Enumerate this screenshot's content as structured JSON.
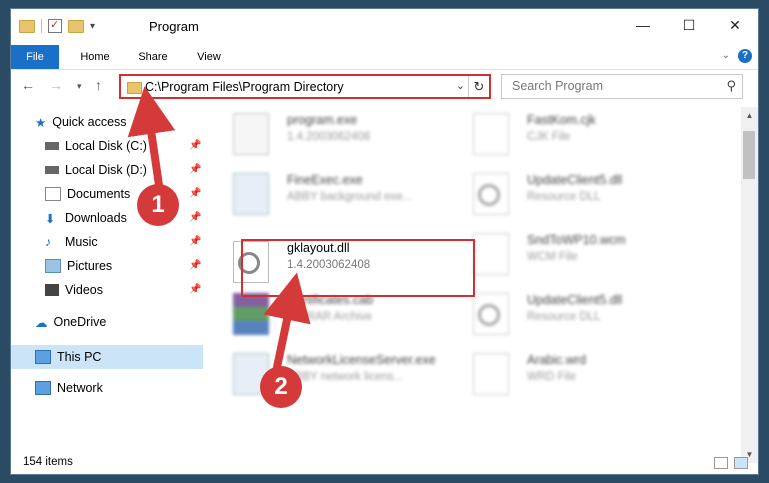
{
  "window": {
    "title": "Program"
  },
  "titlebar": {
    "min": "—",
    "max": "☐",
    "close": "✕"
  },
  "ribbon": {
    "tabs": [
      "File",
      "Home",
      "Share",
      "View"
    ],
    "help": "?"
  },
  "address": {
    "path": "C:\\Program Files\\Program Directory"
  },
  "search": {
    "placeholder": "Search Program"
  },
  "sidebar": {
    "quick_access": "Quick access",
    "items": [
      {
        "label": "Local Disk (C:)",
        "icon": "drive-icon"
      },
      {
        "label": "Local Disk (D:)",
        "icon": "drive-icon"
      },
      {
        "label": "Documents",
        "icon": "documents-icon"
      },
      {
        "label": "Downloads",
        "icon": "downloads-icon"
      },
      {
        "label": "Music",
        "icon": "music-icon"
      },
      {
        "label": "Pictures",
        "icon": "pictures-icon"
      },
      {
        "label": "Videos",
        "icon": "videos-icon"
      }
    ],
    "onedrive": "OneDrive",
    "this_pc": "This PC",
    "network": "Network"
  },
  "files": [
    {
      "name": "program.exe",
      "sub": "1.4.2003062408"
    },
    {
      "name": "FastKom.cjk",
      "sub": "CJK File"
    },
    {
      "name": "FineExec.exe",
      "sub": "ABBY background exe..."
    },
    {
      "name": "UpdateClient5.dll",
      "sub": "Resource DLL"
    },
    {
      "name": "gklayout.dll",
      "sub": "1.4.2003062408"
    },
    {
      "name": "SndToWP10.wcm",
      "sub": "WCM File"
    },
    {
      "name": "Certificates.cab",
      "sub": "WinRAR Archive"
    },
    {
      "name": "UpdateClient5.dll",
      "sub": "Resource DLL"
    },
    {
      "name": "NetworkLicenseServer.exe",
      "sub": "ABBY network licens..."
    },
    {
      "name": "Arabic.wrd",
      "sub": "WRD File"
    }
  ],
  "status": {
    "count": "154 items"
  },
  "callouts": {
    "one": "1",
    "two": "2"
  },
  "colors": {
    "accent": "#1a6fc9",
    "highlight": "#d03030",
    "selected": "#cce4f7"
  }
}
